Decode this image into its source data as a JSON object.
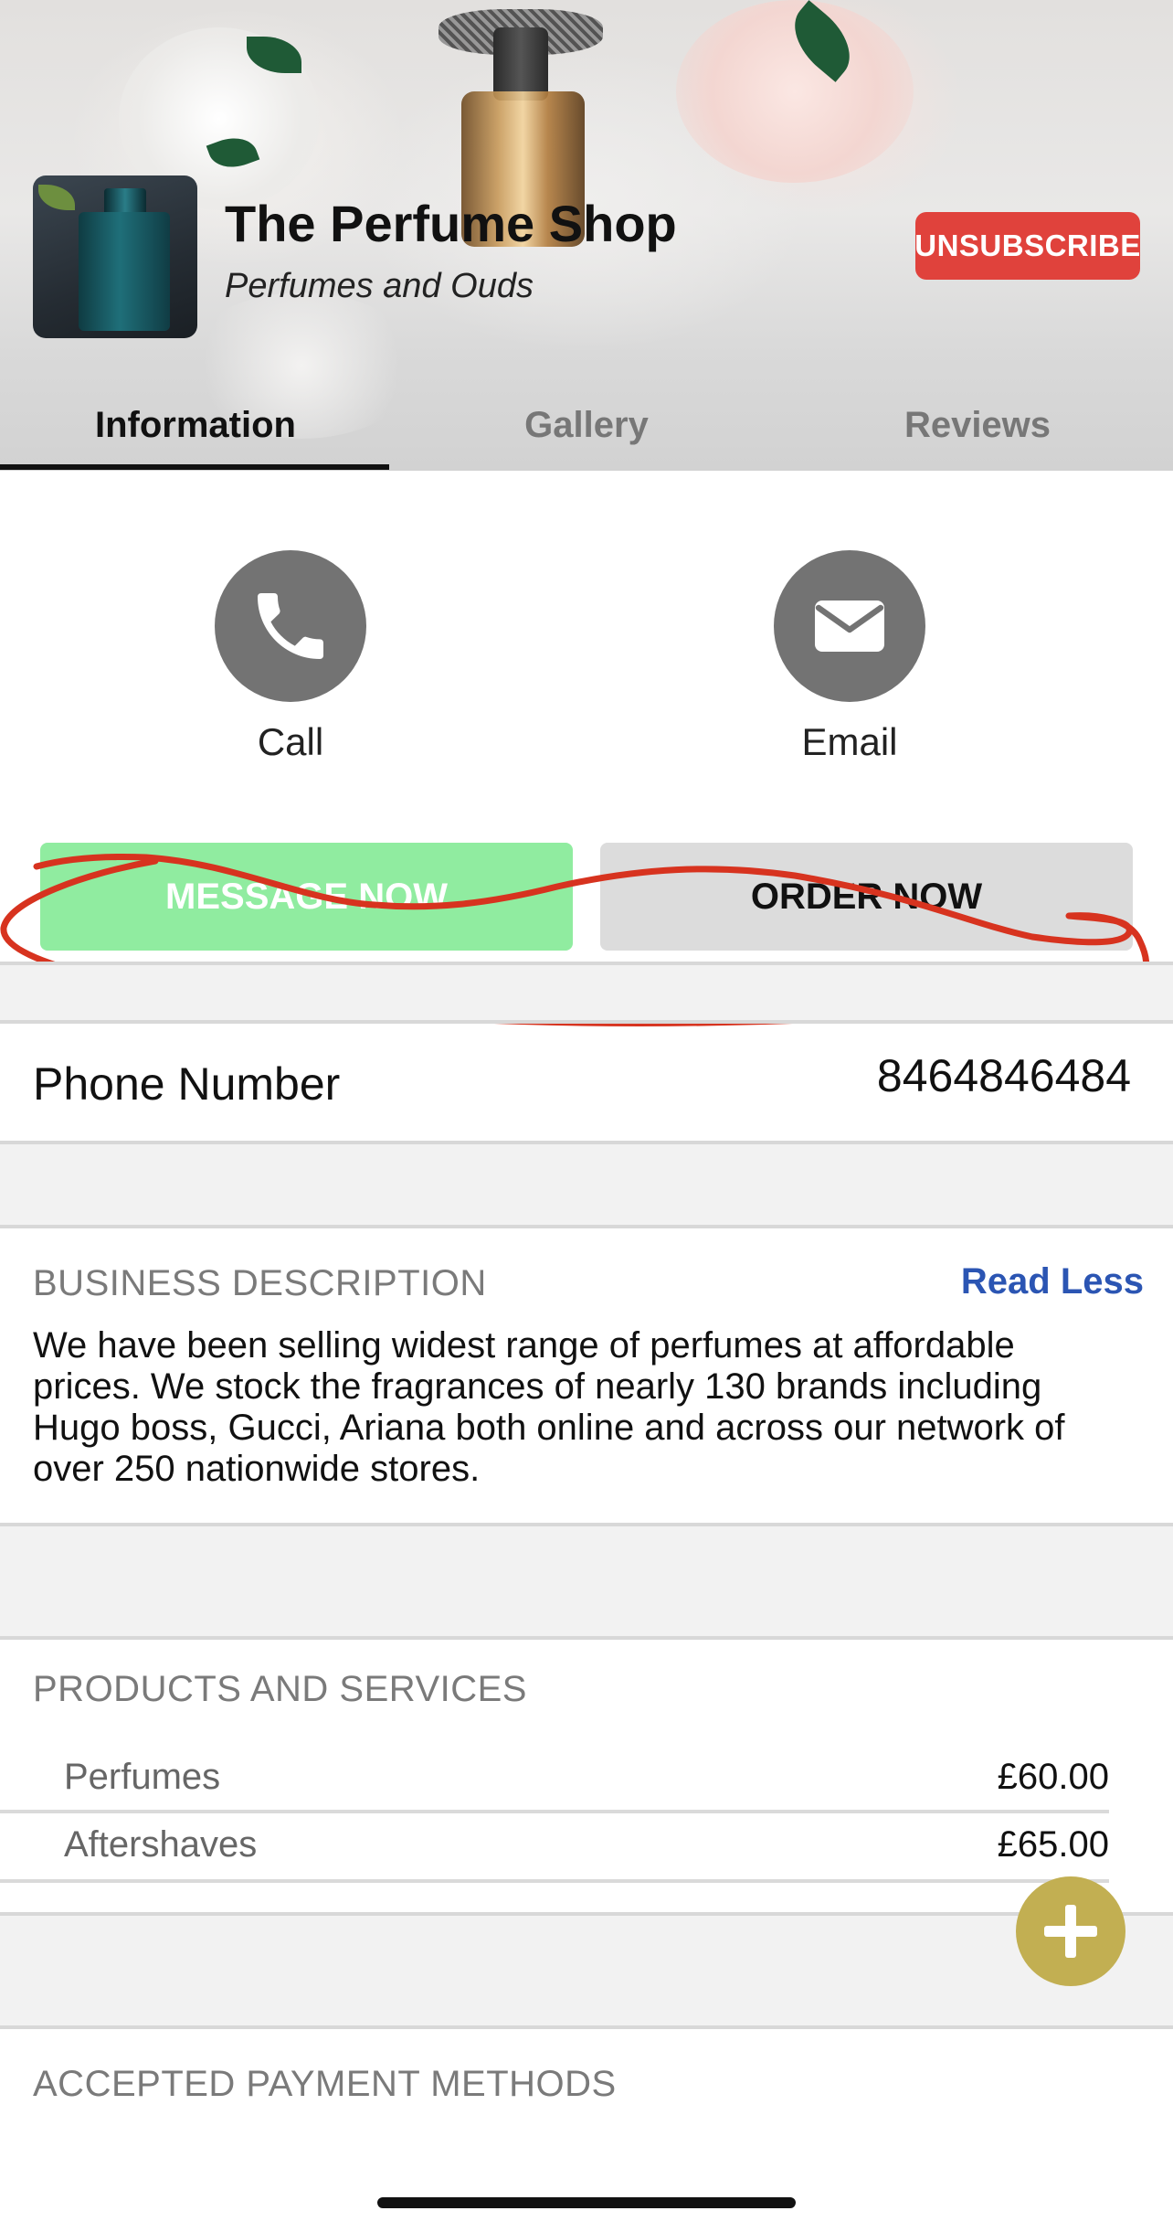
{
  "header": {
    "title": "The Perfume Shop",
    "subtitle": "Perfumes and Ouds",
    "unsubscribe_label": "UNSUBSCRIBE"
  },
  "tabs": [
    {
      "label": "Information",
      "active": true
    },
    {
      "label": "Gallery",
      "active": false
    },
    {
      "label": "Reviews",
      "active": false
    }
  ],
  "actions": {
    "call_label": "Call",
    "email_label": "Email",
    "message_now_label": "MESSAGE NOW",
    "order_now_label": "ORDER NOW"
  },
  "phone": {
    "label": "Phone Number",
    "value": "8464846484"
  },
  "business_description": {
    "heading": "BUSINESS DESCRIPTION",
    "toggle_label": "Read Less",
    "text": "We have been selling widest range of perfumes at affordable prices. We stock the fragrances of nearly 130 brands including Hugo boss, Gucci, Ariana both online and across our network of over 250 nationwide stores."
  },
  "products": {
    "heading": "PRODUCTS AND SERVICES",
    "items": [
      {
        "name": "Perfumes",
        "price": "£60.00"
      },
      {
        "name": "Aftershaves",
        "price": "£65.00"
      }
    ]
  },
  "payment": {
    "heading": "ACCEPTED PAYMENT METHODS"
  },
  "colors": {
    "unsubscribe": "#e0423c",
    "message_now": "#90eca0",
    "order_now": "#dcdcdc",
    "read_less": "#2b55b3",
    "fab": "#c2af52",
    "annotation": "#d7331f"
  },
  "icons": {
    "call": "phone-icon",
    "email": "envelope-icon",
    "fab": "plus-icon"
  }
}
